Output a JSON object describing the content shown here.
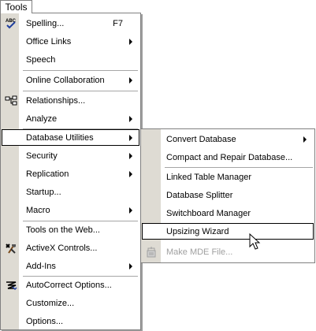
{
  "menubar": {
    "tools_label": "Tools"
  },
  "menu": {
    "items": [
      {
        "label": "Spelling...",
        "shortcut": "F7",
        "icon": "spellcheck-icon"
      },
      {
        "label": "Office Links"
      },
      {
        "label": "Speech"
      },
      {
        "label": "Online Collaboration"
      },
      {
        "label": "Relationships...",
        "icon": "relationships-icon"
      },
      {
        "label": "Analyze"
      },
      {
        "label": "Database Utilities"
      },
      {
        "label": "Security"
      },
      {
        "label": "Replication"
      },
      {
        "label": "Startup..."
      },
      {
        "label": "Macro"
      },
      {
        "label": "Tools on the Web..."
      },
      {
        "label": "ActiveX Controls...",
        "icon": "activex-tools-icon"
      },
      {
        "label": "Add-Ins"
      },
      {
        "label": "AutoCorrect Options...",
        "icon": "autocorrect-icon"
      },
      {
        "label": "Customize..."
      },
      {
        "label": "Options..."
      }
    ]
  },
  "submenu": {
    "items": [
      {
        "label": "Convert Database"
      },
      {
        "label": "Compact and Repair Database..."
      },
      {
        "label": "Linked Table Manager"
      },
      {
        "label": "Database Splitter"
      },
      {
        "label": "Switchboard Manager"
      },
      {
        "label": "Upsizing Wizard"
      },
      {
        "label": "Make MDE File...",
        "icon": "make-mde-icon"
      }
    ]
  },
  "colors": {
    "gutter": "#dedbd3",
    "border": "#808080",
    "disabled_text": "#a0a0a0"
  }
}
